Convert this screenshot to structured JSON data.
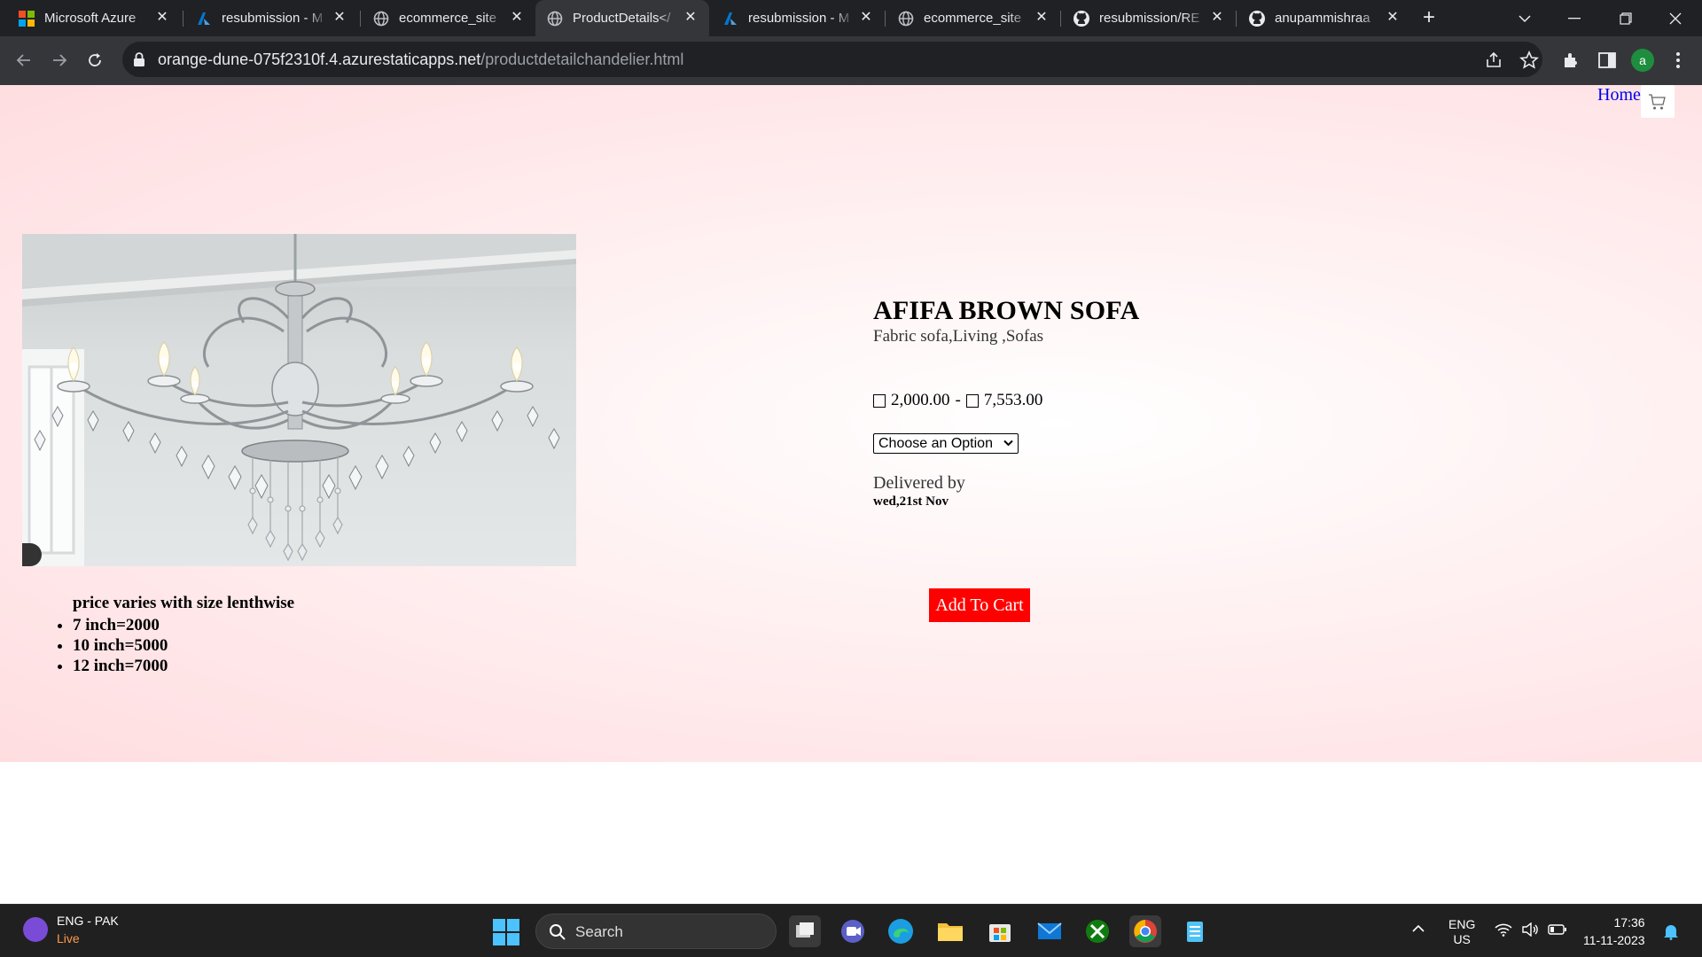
{
  "browser": {
    "tabs": [
      {
        "title": "Microsoft Azure",
        "icon": "microsoft-icon",
        "active": false
      },
      {
        "title": "resubmission - M",
        "icon": "azure-devops-icon",
        "active": false
      },
      {
        "title": "ecommerce_site",
        "icon": "globe-icon",
        "active": false
      },
      {
        "title": "ProductDetails</",
        "icon": "globe-icon",
        "active": true
      },
      {
        "title": "resubmission - M",
        "icon": "azure-devops-icon",
        "active": false
      },
      {
        "title": "ecommerce_site",
        "icon": "globe-icon",
        "active": false
      },
      {
        "title": "resubmission/RE",
        "icon": "github-icon",
        "active": false
      },
      {
        "title": "anupammishraa",
        "icon": "github-icon",
        "active": false
      }
    ],
    "url_host": "orange-dune-075f2310f.4.azurestaticapps.net",
    "url_path": "/productdetailchandelier.html",
    "profile_initial": "a",
    "colors": {
      "tabstrip": "#202124",
      "toolbar": "#35363a"
    }
  },
  "page": {
    "nav": {
      "home_label": "Home"
    },
    "product": {
      "name": "AFIFA BROWN SOFA",
      "category": "Fabric sofa,Living ,Sofas",
      "price_low": "2,000.00",
      "price_sep": "-",
      "price_high": "7,553.00",
      "option_placeholder": "Choose an Option",
      "delivered_label": "Delivered by",
      "delivered_date": "wed,21st Nov",
      "add_to_cart_label": "Add To Cart"
    },
    "size_notes": {
      "heading": "price varies with size lenthwise",
      "items": [
        "7 inch=2000",
        "10 inch=5000",
        "12 inch=7000"
      ]
    },
    "colors": {
      "background": "#ffdde0",
      "add_to_cart": "#ff0000",
      "link": "#0000ee"
    }
  },
  "taskbar": {
    "weather_title": "ENG - PAK",
    "weather_sub": "Live",
    "search_label": "Search",
    "lang_top": "ENG",
    "lang_bottom": "US",
    "time": "17:36",
    "date": "11-11-2023"
  }
}
